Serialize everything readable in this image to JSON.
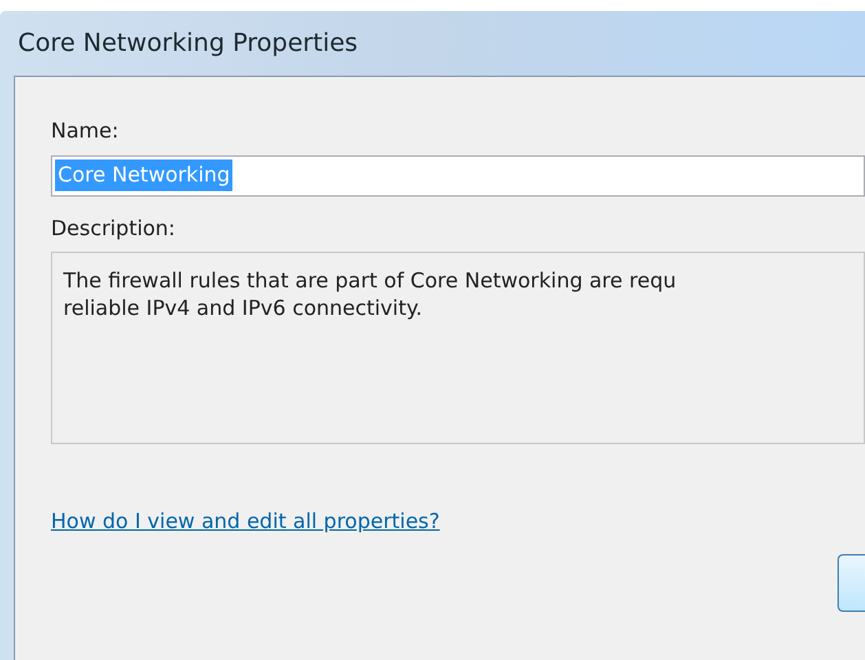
{
  "window": {
    "title": "Core Networking Properties"
  },
  "name_field": {
    "label": "Name:",
    "value": "Core Networking",
    "selected": true
  },
  "description_field": {
    "label": "Description:",
    "value": "The firewall rules that are part of Core Networking are requ\nreliable IPv4 and IPv6 connectivity."
  },
  "help_link": "How do I view and edit all properties?"
}
